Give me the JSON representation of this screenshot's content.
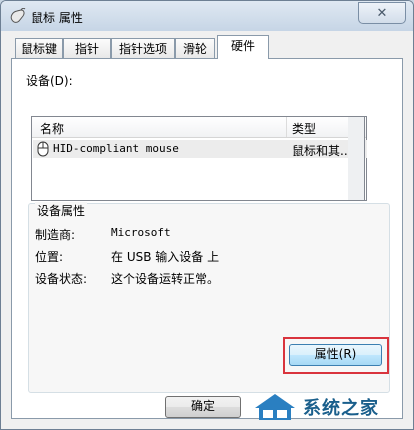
{
  "window": {
    "title": "鼠标 属性",
    "close_symbol": "✕"
  },
  "tabs": [
    {
      "label": "鼠标键",
      "active": false
    },
    {
      "label": "指针",
      "active": false
    },
    {
      "label": "指针选项",
      "active": false
    },
    {
      "label": "滑轮",
      "active": false
    },
    {
      "label": "硬件",
      "active": true
    }
  ],
  "devices": {
    "label": "设备(D):",
    "columns": [
      "名称",
      "类型"
    ],
    "rows": [
      {
        "name": "HID-compliant mouse",
        "type": "鼠标和其..."
      }
    ]
  },
  "properties": {
    "group_title": "设备属性",
    "manufacturer_label": "制造商:",
    "manufacturer_value": "Microsoft",
    "location_label": "位置:",
    "location_value": "在 USB 输入设备 上",
    "status_label": "设备状态:",
    "status_value": "这个设备运转正常。",
    "properties_button": "属性(R)"
  },
  "footer": {
    "ok_button": "确定"
  },
  "watermark": {
    "text": "系统之家"
  },
  "colors": {
    "highlight": "#d9343d",
    "accent": "#3c7fb1"
  }
}
